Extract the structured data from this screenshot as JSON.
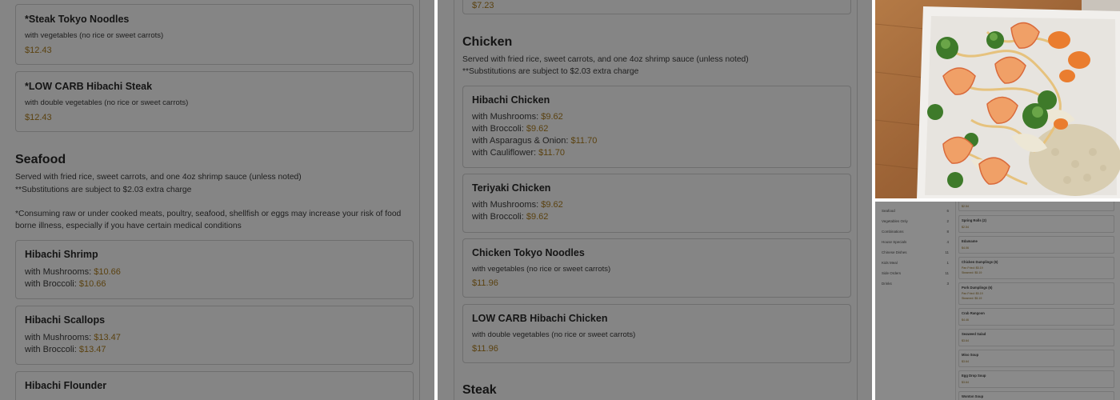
{
  "left_panel": {
    "cards_top": [
      {
        "title": "*Steak Tokyo Noodles",
        "subtitle": "with vegetables (no rice or sweet carrots)",
        "price": "$12.43"
      },
      {
        "title": "*LOW CARB Hibachi Steak",
        "subtitle": "with double vegetables (no rice or sweet carrots)",
        "price": "$12.43"
      }
    ],
    "section_title": "Seafood",
    "section_note_1": "Served with fried rice, sweet carrots, and one 4oz shrimp sauce (unless noted)",
    "section_note_2": "**Substitutions are subject to $2.03 extra charge",
    "section_note_3": "*Consuming raw or under cooked meats, poultry, seafood, shellfish or eggs may increase your risk of food borne illness, especially if you have certain medical conditions",
    "cards": [
      {
        "title": "Hibachi Shrimp",
        "options": [
          {
            "label": "with Mushrooms: ",
            "price": "$10.66"
          },
          {
            "label": "with Broccoli: ",
            "price": "$10.66"
          }
        ]
      },
      {
        "title": "Hibachi Scallops",
        "options": [
          {
            "label": "with Mushrooms: ",
            "price": "$13.47"
          },
          {
            "label": "with Broccoli: ",
            "price": "$13.47"
          }
        ]
      },
      {
        "title": "Hibachi Flounder"
      }
    ]
  },
  "mid_panel": {
    "top_price_partial": "$7.23",
    "section_title": "Chicken",
    "section_note_1": "Served with fried rice, sweet carrots, and one 4oz shrimp sauce (unless noted)",
    "section_note_2": "**Substitutions are subject to $2.03 extra charge",
    "cards": [
      {
        "title": "Hibachi Chicken",
        "options": [
          {
            "label": "with Mushrooms: ",
            "price": "$9.62"
          },
          {
            "label": "with Broccoli: ",
            "price": "$9.62"
          },
          {
            "label": "with Asparagus & Onion: ",
            "price": "$11.70"
          },
          {
            "label": "with Cauliflower: ",
            "price": "$11.70"
          }
        ]
      },
      {
        "title": "Teriyaki Chicken",
        "options": [
          {
            "label": "with Mushrooms: ",
            "price": "$9.62"
          },
          {
            "label": "with Broccoli: ",
            "price": "$9.62"
          }
        ]
      },
      {
        "title": "Chicken Tokyo Noodles",
        "subtitle": "with vegetables (no rice or sweet carrots)",
        "price": "$11.96"
      },
      {
        "title": "LOW CARB Hibachi Chicken",
        "subtitle": "with double vegetables (no rice or sweet carrots)",
        "price": "$11.96"
      }
    ],
    "next_section_title": "Steak"
  },
  "thumb_panel": {
    "sidebar": [
      {
        "label": "Seafood",
        "count": "6"
      },
      {
        "label": "Vegetables Only",
        "count": "2"
      },
      {
        "label": "Combinations",
        "count": "8"
      },
      {
        "label": "House Specials",
        "count": "4"
      },
      {
        "label": "Chinese Dishes",
        "count": "11"
      },
      {
        "label": "Kids Meal",
        "count": "1"
      },
      {
        "label": "Side Orders",
        "count": "11"
      },
      {
        "label": "Drinks",
        "count": "3"
      }
    ],
    "top_price": "$2.54",
    "cards": [
      {
        "title": "Spring Rolls (2)",
        "lines": [
          "$2.54"
        ]
      },
      {
        "title": "Edamame",
        "lines": [
          "$4.06"
        ]
      },
      {
        "title": "Chicken Dumplings (6)",
        "lines": [
          "Pan Fried: $5.19",
          "Steamed: $5.19"
        ]
      },
      {
        "title": "Pork Dumplings (6)",
        "lines": [
          "Pan Fried: $5.19",
          "Steamed: $5.19"
        ]
      },
      {
        "title": "Crab Rangoon",
        "lines": [
          "$4.46"
        ]
      },
      {
        "title": "Seaweed Salad",
        "lines": [
          "$3.64"
        ]
      },
      {
        "title": "Miso Soup",
        "lines": [
          "$3.64"
        ]
      },
      {
        "title": "Egg Drop Soup",
        "lines": [
          "$3.64"
        ]
      },
      {
        "title": "Wonton Soup",
        "lines": []
      }
    ]
  },
  "colors": {
    "overlay_gray": "#858585",
    "price_color": "#5b4210"
  }
}
